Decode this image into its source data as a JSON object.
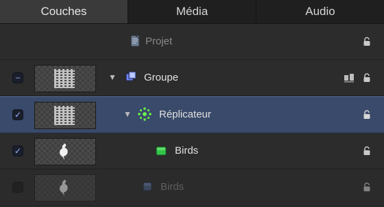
{
  "tabs": [
    {
      "label": "Couches",
      "active": true
    },
    {
      "label": "Média",
      "active": false
    },
    {
      "label": "Audio",
      "active": false
    }
  ],
  "rows": [
    {
      "type": "project",
      "label": "Projet",
      "selected": false,
      "dim": false,
      "checkbox": "none"
    },
    {
      "type": "group",
      "label": "Groupe",
      "selected": false,
      "dim": false,
      "checkbox": "mixed",
      "expanded": true
    },
    {
      "type": "replicator",
      "label": "Réplicateur",
      "selected": true,
      "dim": false,
      "checkbox": "checked",
      "expanded": true
    },
    {
      "type": "birds",
      "label": "Birds",
      "selected": false,
      "dim": false,
      "checkbox": "checked"
    },
    {
      "type": "birds-dim",
      "label": "Birds",
      "selected": false,
      "dim": true,
      "checkbox": "empty"
    }
  ],
  "icons": {
    "project": "project-file-icon",
    "group": "group-layer-icon",
    "replicator": "replicator-icon",
    "birds": "shape-square-icon",
    "birds_dim": "shape-square-icon",
    "lock": "lock-icon",
    "alignment": "alignment-icon"
  },
  "colors": {
    "selected_bg": "#3a4a6a",
    "accent_blue": "#9fb3ff",
    "birds_green": "#33c449",
    "replicator_green": "#6cff4a"
  }
}
